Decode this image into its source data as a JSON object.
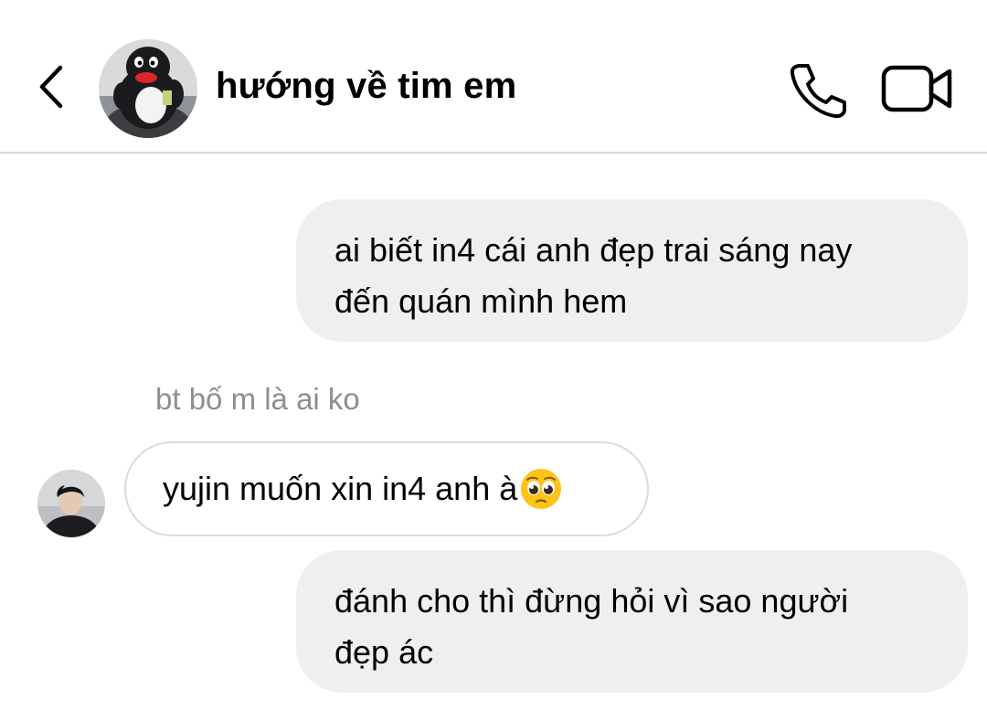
{
  "header": {
    "title": "hướng về tim em",
    "back_icon": "chevron-left-icon",
    "call_icon": "phone-icon",
    "video_icon": "video-camera-icon",
    "avatar_desc": "penguin-plush-avatar"
  },
  "messages": [
    {
      "direction": "outgoing",
      "text_line1": "ai biết in4 cái anh đẹp trai sáng nay",
      "text_line2": "đến quán mình hem"
    },
    {
      "direction": "incoming",
      "reply_context": "bt bố m là ai ko",
      "text": "yujin muốn xin in4 anh à",
      "emoji": "pleading-face-icon"
    },
    {
      "direction": "outgoing",
      "text_line1": "đánh cho thì đừng hỏi vì sao người",
      "text_line2": "đẹp ác"
    }
  ],
  "colors": {
    "outgoing_bubble": "#efefef",
    "incoming_border": "#dbdbdb",
    "muted_text": "#8e8e8e",
    "divider": "#dbdbdb"
  }
}
